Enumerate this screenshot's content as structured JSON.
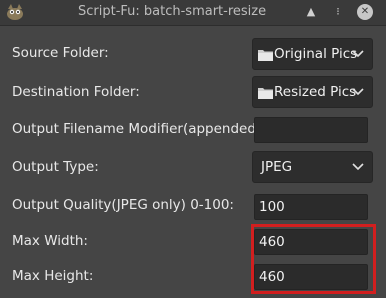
{
  "window": {
    "title": "Script-Fu: batch-smart-resize",
    "icons": {
      "app": "gimp-app-icon",
      "up": "triangle-up-icon",
      "menu": "dots-icon",
      "close": "close-icon"
    }
  },
  "form": {
    "source_folder": {
      "label": "Source Folder:",
      "value": "Original Pics"
    },
    "destination_folder": {
      "label": "Destination Folder:",
      "value": "Resized Pics"
    },
    "filename_modifier": {
      "label": "Output Filename Modifier(appended):",
      "value": ""
    },
    "output_type": {
      "label": "Output Type:",
      "value": "JPEG"
    },
    "output_quality": {
      "label": "Output Quality(JPEG only) 0-100:",
      "value": "100"
    },
    "max_width": {
      "label": "Max Width:",
      "value": "460"
    },
    "max_height": {
      "label": "Max Height:",
      "value": "460"
    }
  },
  "colors": {
    "highlight": "#d21f1f",
    "background": "#454545"
  }
}
